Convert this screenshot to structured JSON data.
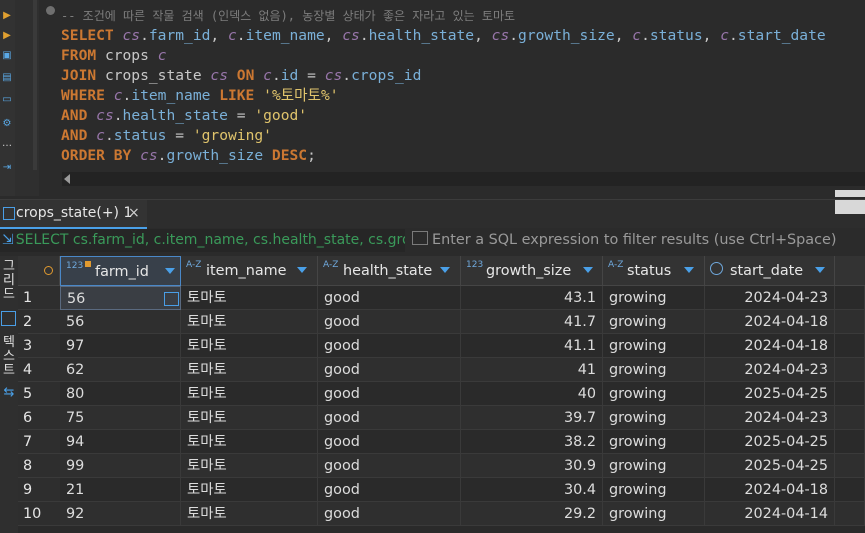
{
  "editor": {
    "lines": [
      "-- 조건에 따른 작물 검색 (인덱스 없음), 농장별 상태가 좋은 자라고 있는 토마토",
      "SELECT cs.farm_id, c.item_name, cs.health_state, cs.growth_size, c.status, c.start_date",
      "FROM crops c",
      "JOIN crops_state cs ON c.id = cs.crops_id",
      "WHERE c.item_name LIKE '%토마토%'",
      "AND cs.health_state = 'good'",
      "AND c.status = 'growing'",
      "ORDER BY cs.growth_size DESC;"
    ]
  },
  "results_tab": {
    "label": "crops_state(+) 1",
    "close": "×"
  },
  "filter": {
    "query": "SELECT cs.farm_id, c.item_name, cs.health_state, cs.growth_",
    "placeholder": "Enter a SQL expression to filter results (use Ctrl+Space)"
  },
  "side_labels": [
    "그리드",
    "텍스트"
  ],
  "columns": [
    {
      "type": "123",
      "label": "farm_id"
    },
    {
      "type": "A-Z",
      "label": "item_name"
    },
    {
      "type": "A-Z",
      "label": "health_state"
    },
    {
      "type": "123",
      "label": "growth_size"
    },
    {
      "type": "A-Z",
      "label": "status"
    },
    {
      "type": "clock",
      "label": "start_date"
    }
  ],
  "rows": [
    {
      "n": "1",
      "farm_id": "56",
      "item_name": "토마토",
      "health_state": "good",
      "growth_size": "43.1",
      "status": "growing",
      "start_date": "2024-04-23"
    },
    {
      "n": "2",
      "farm_id": "56",
      "item_name": "토마토",
      "health_state": "good",
      "growth_size": "41.7",
      "status": "growing",
      "start_date": "2024-04-18"
    },
    {
      "n": "3",
      "farm_id": "97",
      "item_name": "토마토",
      "health_state": "good",
      "growth_size": "41.1",
      "status": "growing",
      "start_date": "2024-04-18"
    },
    {
      "n": "4",
      "farm_id": "62",
      "item_name": "토마토",
      "health_state": "good",
      "growth_size": "41",
      "status": "growing",
      "start_date": "2024-04-23"
    },
    {
      "n": "5",
      "farm_id": "80",
      "item_name": "토마토",
      "health_state": "good",
      "growth_size": "40",
      "status": "growing",
      "start_date": "2025-04-25"
    },
    {
      "n": "6",
      "farm_id": "75",
      "item_name": "토마토",
      "health_state": "good",
      "growth_size": "39.7",
      "status": "growing",
      "start_date": "2024-04-23"
    },
    {
      "n": "7",
      "farm_id": "94",
      "item_name": "토마토",
      "health_state": "good",
      "growth_size": "38.2",
      "status": "growing",
      "start_date": "2025-04-25"
    },
    {
      "n": "8",
      "farm_id": "99",
      "item_name": "토마토",
      "health_state": "good",
      "growth_size": "30.9",
      "status": "growing",
      "start_date": "2025-04-25"
    },
    {
      "n": "9",
      "farm_id": "21",
      "item_name": "토마토",
      "health_state": "good",
      "growth_size": "30.4",
      "status": "growing",
      "start_date": "2024-04-18"
    },
    {
      "n": "10",
      "farm_id": "92",
      "item_name": "토마토",
      "health_state": "good",
      "growth_size": "29.2",
      "status": "growing",
      "start_date": "2024-04-14"
    }
  ],
  "colors": {
    "accent": "#4aa0e8",
    "keyword": "#cc7832",
    "string": "#e0c46c",
    "filter_text": "#3a9a5a"
  }
}
